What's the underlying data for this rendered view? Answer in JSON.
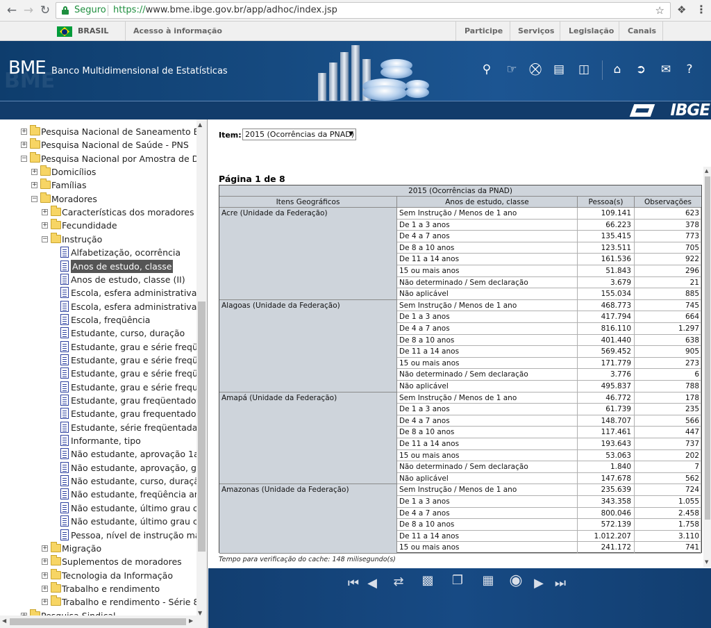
{
  "browser": {
    "secure_label": "Seguro",
    "url_protocol": "https://",
    "url_rest": "www.bme.ibge.gov.br/app/adhoc/index.jsp"
  },
  "gov_bar": {
    "country": "BRASIL",
    "access_info": "Acesso à informação",
    "links": [
      "Participe",
      "Serviços",
      "Legislação",
      "Canais"
    ]
  },
  "header": {
    "logo": "BME",
    "subtitle": "Banco Multidimensional de Estatísticas",
    "brand": "IBGE",
    "icons": [
      "search-icon",
      "add-to-cart-icon",
      "cart-add-icon",
      "cart-icon",
      "trash-icon",
      "home-icon",
      "exit-icon",
      "mail-icon",
      "help-icon"
    ]
  },
  "tree": [
    {
      "level": 0,
      "type": "folder",
      "toggle": "+",
      "label": "Pesquisa Nacional de Saneamento B"
    },
    {
      "level": 0,
      "type": "folder",
      "toggle": "+",
      "label": "Pesquisa Nacional de Saúde - PNS"
    },
    {
      "level": 0,
      "type": "folder",
      "toggle": "-",
      "label": "Pesquisa Nacional por Amostra de D"
    },
    {
      "level": 1,
      "type": "folder",
      "toggle": "+",
      "label": "Domicílios"
    },
    {
      "level": 1,
      "type": "folder",
      "toggle": "+",
      "label": "Famílias"
    },
    {
      "level": 1,
      "type": "folder",
      "toggle": "-",
      "label": "Moradores"
    },
    {
      "level": 2,
      "type": "folder",
      "toggle": "+",
      "label": "Características dos moradores"
    },
    {
      "level": 2,
      "type": "folder",
      "toggle": "+",
      "label": "Fecundidade"
    },
    {
      "level": 2,
      "type": "folder",
      "toggle": "-",
      "label": "Instrução"
    },
    {
      "level": 3,
      "type": "doc",
      "label": "Alfabetização, ocorrência"
    },
    {
      "level": 3,
      "type": "doc",
      "label": "Anos de estudo, classe",
      "selected": true
    },
    {
      "level": 3,
      "type": "doc",
      "label": "Anos de estudo, classe (II)"
    },
    {
      "level": 3,
      "type": "doc",
      "label": "Escola, esfera administrativa"
    },
    {
      "level": 3,
      "type": "doc",
      "label": "Escola, esfera administrativa"
    },
    {
      "level": 3,
      "type": "doc",
      "label": "Escola, freqüência"
    },
    {
      "level": 3,
      "type": "doc",
      "label": "Estudante, curso, duração"
    },
    {
      "level": 3,
      "type": "doc",
      "label": "Estudante, grau e série freqü"
    },
    {
      "level": 3,
      "type": "doc",
      "label": "Estudante, grau e série freqü"
    },
    {
      "level": 3,
      "type": "doc",
      "label": "Estudante, grau e série freqü"
    },
    {
      "level": 3,
      "type": "doc",
      "label": "Estudante, grau e série frequ"
    },
    {
      "level": 3,
      "type": "doc",
      "label": "Estudante, grau freqüentado"
    },
    {
      "level": 3,
      "type": "doc",
      "label": "Estudante, grau frequentado"
    },
    {
      "level": 3,
      "type": "doc",
      "label": "Estudante, série freqüentada"
    },
    {
      "level": 3,
      "type": "doc",
      "label": "Informante, tipo"
    },
    {
      "level": 3,
      "type": "doc",
      "label": "Não estudante, aprovação 1a"
    },
    {
      "level": 3,
      "type": "doc",
      "label": "Não estudante, aprovação, gr"
    },
    {
      "level": 3,
      "type": "doc",
      "label": "Não estudante, curso, duraçã"
    },
    {
      "level": 3,
      "type": "doc",
      "label": "Não estudante, freqüência an"
    },
    {
      "level": 3,
      "type": "doc",
      "label": "Não estudante, último grau c"
    },
    {
      "level": 3,
      "type": "doc",
      "label": "Não estudante, último grau c"
    },
    {
      "level": 3,
      "type": "doc",
      "label": "Pessoa, nível de instrução ma"
    },
    {
      "level": 2,
      "type": "folder",
      "toggle": "+",
      "label": "Migração"
    },
    {
      "level": 2,
      "type": "folder",
      "toggle": "+",
      "label": "Suplementos de moradores"
    },
    {
      "level": 2,
      "type": "folder",
      "toggle": "+",
      "label": "Tecnologia da Informação"
    },
    {
      "level": 2,
      "type": "folder",
      "toggle": "+",
      "label": "Trabalho e rendimento"
    },
    {
      "level": 2,
      "type": "folder",
      "toggle": "+",
      "label": "Trabalho e rendimento - Série 8"
    },
    {
      "level": 0,
      "type": "folder",
      "toggle": "+",
      "label": "Pesquisa Sindical"
    }
  ],
  "content": {
    "item_label": "Item:",
    "item_value": "2015 (Ocorrências da PNAD)",
    "page_info": "Página 1 de 8",
    "table_title": "2015 (Ocorrências da PNAD)",
    "columns": [
      "Itens Geográficos",
      "Anos de estudo, classe",
      "Pessoa(s)",
      "Observações"
    ],
    "groups": [
      {
        "name": "Acre (Unidade da Federação)",
        "rows": [
          [
            "Sem Instrução / Menos de 1 ano",
            "109.141",
            "623"
          ],
          [
            "De 1 a 3 anos",
            "66.223",
            "378"
          ],
          [
            "De 4 a 7 anos",
            "135.415",
            "773"
          ],
          [
            "De 8 a 10 anos",
            "123.511",
            "705"
          ],
          [
            "De 11 a 14 anos",
            "161.536",
            "922"
          ],
          [
            "15 ou mais anos",
            "51.843",
            "296"
          ],
          [
            "Não determinado / Sem declaração",
            "3.679",
            "21"
          ],
          [
            "Não aplicável",
            "155.034",
            "885"
          ]
        ]
      },
      {
        "name": "Alagoas (Unidade da Federação)",
        "rows": [
          [
            "Sem Instrução / Menos de 1 ano",
            "468.773",
            "745"
          ],
          [
            "De 1 a 3 anos",
            "417.794",
            "664"
          ],
          [
            "De 4 a 7 anos",
            "816.110",
            "1.297"
          ],
          [
            "De 8 a 10 anos",
            "401.440",
            "638"
          ],
          [
            "De 11 a 14 anos",
            "569.452",
            "905"
          ],
          [
            "15 ou mais anos",
            "171.779",
            "273"
          ],
          [
            "Não determinado / Sem declaração",
            "3.776",
            "6"
          ],
          [
            "Não aplicável",
            "495.837",
            "788"
          ]
        ]
      },
      {
        "name": "Amapá (Unidade da Federação)",
        "rows": [
          [
            "Sem Instrução / Menos de 1 ano",
            "46.772",
            "178"
          ],
          [
            "De 1 a 3 anos",
            "61.739",
            "235"
          ],
          [
            "De 4 a 7 anos",
            "148.707",
            "566"
          ],
          [
            "De 8 a 10 anos",
            "117.461",
            "447"
          ],
          [
            "De 11 a 14 anos",
            "193.643",
            "737"
          ],
          [
            "15 ou mais anos",
            "53.063",
            "202"
          ],
          [
            "Não determinado / Sem declaração",
            "1.840",
            "7"
          ],
          [
            "Não aplicável",
            "147.678",
            "562"
          ]
        ]
      },
      {
        "name": "Amazonas (Unidade da Federação)",
        "rows": [
          [
            "Sem Instrução / Menos de 1 ano",
            "235.639",
            "724"
          ],
          [
            "De 1 a 3 anos",
            "343.358",
            "1.055"
          ],
          [
            "De 4 a 7 anos",
            "800.046",
            "2.458"
          ],
          [
            "De 8 a 10 anos",
            "572.139",
            "1.758"
          ],
          [
            "De 11 a 14 anos",
            "1.012.207",
            "3.110"
          ],
          [
            "15 ou mais anos",
            "241.172",
            "741"
          ]
        ]
      }
    ],
    "cache_note": "Tempo para verificação do cache: 148 milisegundo(s)"
  },
  "footer": {
    "icons": [
      "first-page-icon",
      "previous-page-icon",
      "refresh-icon",
      "save-icon",
      "windows-icon",
      "calendar-grid-icon",
      "globe-icon",
      "next-page-icon",
      "last-page-icon"
    ]
  },
  "colors": {
    "header_blue": "#174c83",
    "table_header_gray": "#ced4db",
    "secure_green": "#1e8e3e"
  }
}
